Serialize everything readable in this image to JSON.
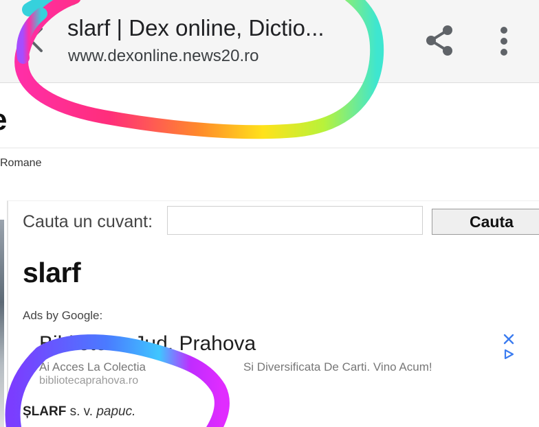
{
  "browser": {
    "tab_title": "slarf | Dex online, Dictio...",
    "url": "www.dexonline.news20.ro",
    "icons": {
      "back": "back-arrow-icon",
      "share": "share-icon",
      "menu": "more-vertical-icon"
    }
  },
  "site": {
    "logo_fragment": "e",
    "subtitle": "Romane"
  },
  "search": {
    "label": "Cauta un cuvant:",
    "value": "",
    "button_label": "Cauta"
  },
  "entry": {
    "title": "slarf",
    "definition": {
      "headword": "ȘLARF",
      "grammar": "s. v.",
      "target": "papuc."
    }
  },
  "ad": {
    "label": "Ads by Google:",
    "headline": "Biblioteca Jud. Prahova",
    "description": "Ai Acces La Colectia ... Si Diversificata De Carti. Vino Acum!",
    "description_left": "Ai Acces La Colectia",
    "description_right": "Si Diversificata De Carti. Vino Acum!",
    "domain": "bibliotecaprahova.ro",
    "icons": {
      "close": "close-icon",
      "adchoices": "adchoices-icon"
    }
  },
  "colors": {
    "toolbar_bg": "#f5f5f5",
    "text_primary": "#202124",
    "ad_icon": "#3b7cf0",
    "scribble_stops": [
      "#36d1dc",
      "#5b86e5",
      "#b721ff",
      "#ff2ea6",
      "#ff6a3d",
      "#ffd200",
      "#c9f23a",
      "#3ee6b0",
      "#45c7ff"
    ]
  }
}
